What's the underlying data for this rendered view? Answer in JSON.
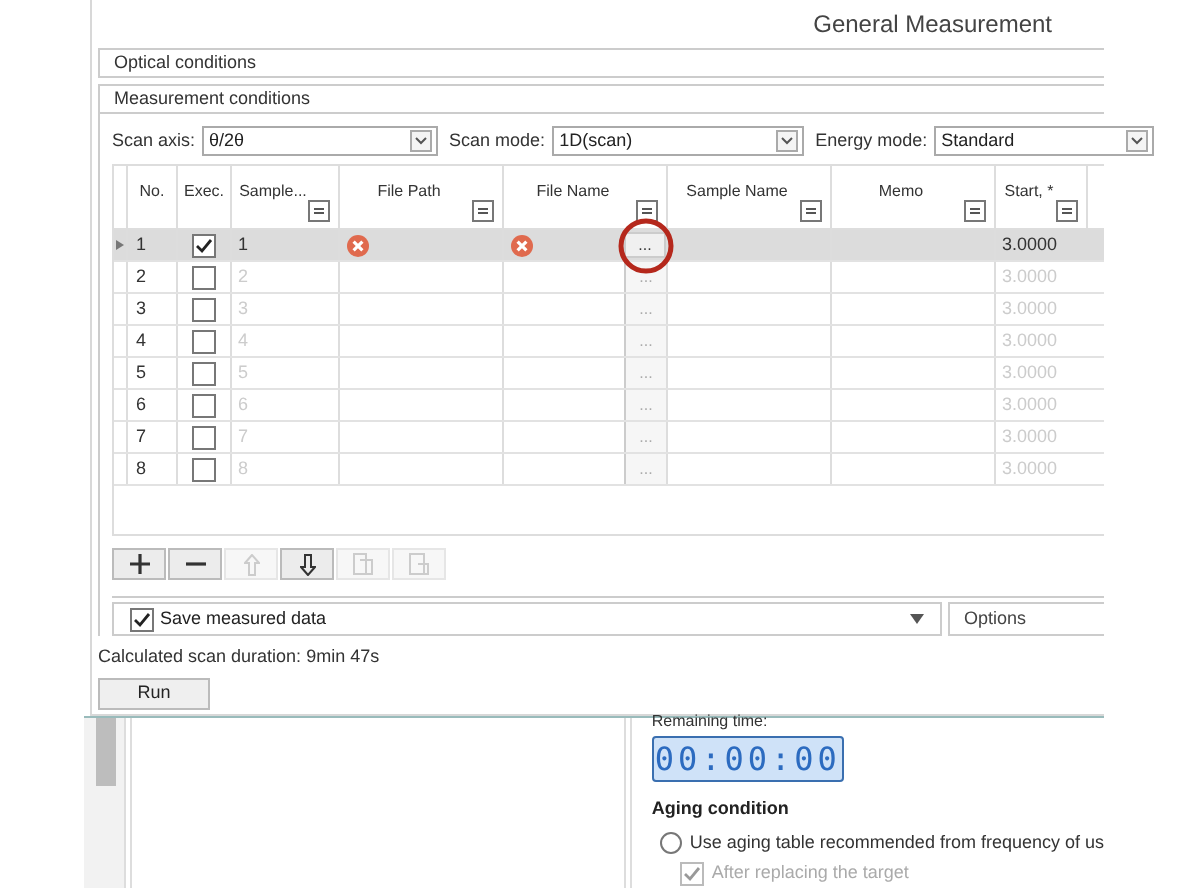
{
  "window": {
    "title": "General Measurement"
  },
  "sections": [
    {
      "label": "Optical conditions"
    },
    {
      "label": "Measurement conditions"
    }
  ],
  "selectors": [
    {
      "label": "Scan axis:",
      "value": "θ/2θ"
    },
    {
      "label": "Scan mode:",
      "value": "1D(scan)"
    },
    {
      "label": "Energy mode:",
      "value": "Standard"
    }
  ],
  "table": {
    "columns": [
      "No.",
      "Exec.",
      "Sample...",
      "File Path",
      "File Name",
      "Sample Name",
      "Memo",
      "Start, *"
    ],
    "rows": [
      {
        "no": "1",
        "exec": true,
        "sample": "1",
        "path_error": true,
        "name_error": true,
        "browse": "...",
        "start": "3.0000",
        "selected": true
      },
      {
        "no": "2",
        "exec": false,
        "sample": "2",
        "path_error": false,
        "name_error": false,
        "browse": "...",
        "start": "3.0000",
        "selected": false
      },
      {
        "no": "3",
        "exec": false,
        "sample": "3",
        "path_error": false,
        "name_error": false,
        "browse": "...",
        "start": "3.0000",
        "selected": false
      },
      {
        "no": "4",
        "exec": false,
        "sample": "4",
        "path_error": false,
        "name_error": false,
        "browse": "...",
        "start": "3.0000",
        "selected": false
      },
      {
        "no": "5",
        "exec": false,
        "sample": "5",
        "path_error": false,
        "name_error": false,
        "browse": "...",
        "start": "3.0000",
        "selected": false
      },
      {
        "no": "6",
        "exec": false,
        "sample": "6",
        "path_error": false,
        "name_error": false,
        "browse": "...",
        "start": "3.0000",
        "selected": false
      },
      {
        "no": "7",
        "exec": false,
        "sample": "7",
        "path_error": false,
        "name_error": false,
        "browse": "...",
        "start": "3.0000",
        "selected": false
      },
      {
        "no": "8",
        "exec": false,
        "sample": "8",
        "path_error": false,
        "name_error": false,
        "browse": "...",
        "start": "3.0000",
        "selected": false
      }
    ]
  },
  "row_tools": [
    {
      "kind": "add",
      "disabled": false
    },
    {
      "kind": "remove",
      "disabled": false
    },
    {
      "kind": "up",
      "disabled": true
    },
    {
      "kind": "down",
      "disabled": false
    },
    {
      "kind": "copy",
      "disabled": true
    },
    {
      "kind": "paste",
      "disabled": true
    }
  ],
  "save": {
    "label": "Save measured data",
    "checked": true
  },
  "options": {
    "label": "Options"
  },
  "duration": "Calculated scan duration: 9min 47s",
  "run": {
    "label": "Run"
  },
  "background": {
    "remaining_label": "Remaining time:",
    "timer": "00:00:00",
    "aging_title": "Aging condition",
    "radio": {
      "label": "Use aging table recommended from frequency of us",
      "selected": false
    },
    "check": {
      "label": "After replacing the target",
      "checked": true,
      "disabled": true
    }
  }
}
